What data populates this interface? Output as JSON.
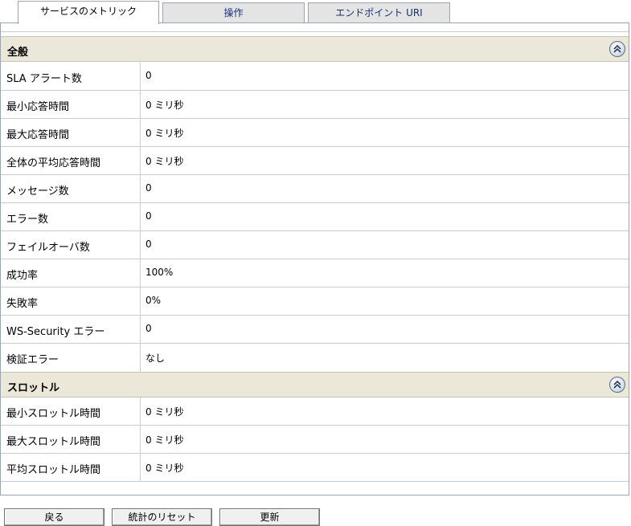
{
  "tabs": [
    {
      "label": "サービスのメトリック",
      "active": true
    },
    {
      "label": "操作",
      "active": false
    },
    {
      "label": "エンドポイント URI",
      "active": false
    }
  ],
  "sections": {
    "general": {
      "title": "全般",
      "rows": [
        {
          "label": "SLA アラート数",
          "value": "0"
        },
        {
          "label": "最小応答時間",
          "value": "0 ミリ秒"
        },
        {
          "label": "最大応答時間",
          "value": "0 ミリ秒"
        },
        {
          "label": "全体の平均応答時間",
          "value": "0 ミリ秒"
        },
        {
          "label": "メッセージ数",
          "value": "0"
        },
        {
          "label": "エラー数",
          "value": "0"
        },
        {
          "label": "フェイルオーバ数",
          "value": "0"
        },
        {
          "label": "成功率",
          "value": "100%"
        },
        {
          "label": "失敗率",
          "value": "0%"
        },
        {
          "label": "WS-Security エラー",
          "value": "0"
        },
        {
          "label": "検証エラー",
          "value": "なし"
        }
      ]
    },
    "throttle": {
      "title": "スロットル",
      "rows": [
        {
          "label": "最小スロットル時間",
          "value": "0 ミリ秒"
        },
        {
          "label": "最大スロットル時間",
          "value": "0 ミリ秒"
        },
        {
          "label": "平均スロットル時間",
          "value": "0 ミリ秒"
        }
      ]
    }
  },
  "buttons": {
    "back": "戻る",
    "reset_stats": "統計のリセット",
    "update": "更新"
  },
  "icons": {
    "collapse": "double-chevron-up-icon"
  },
  "colors": {
    "section_header_bg": "#ebe7d9",
    "tab_text": "#1a2f7a",
    "border": "#9aa4b2"
  }
}
